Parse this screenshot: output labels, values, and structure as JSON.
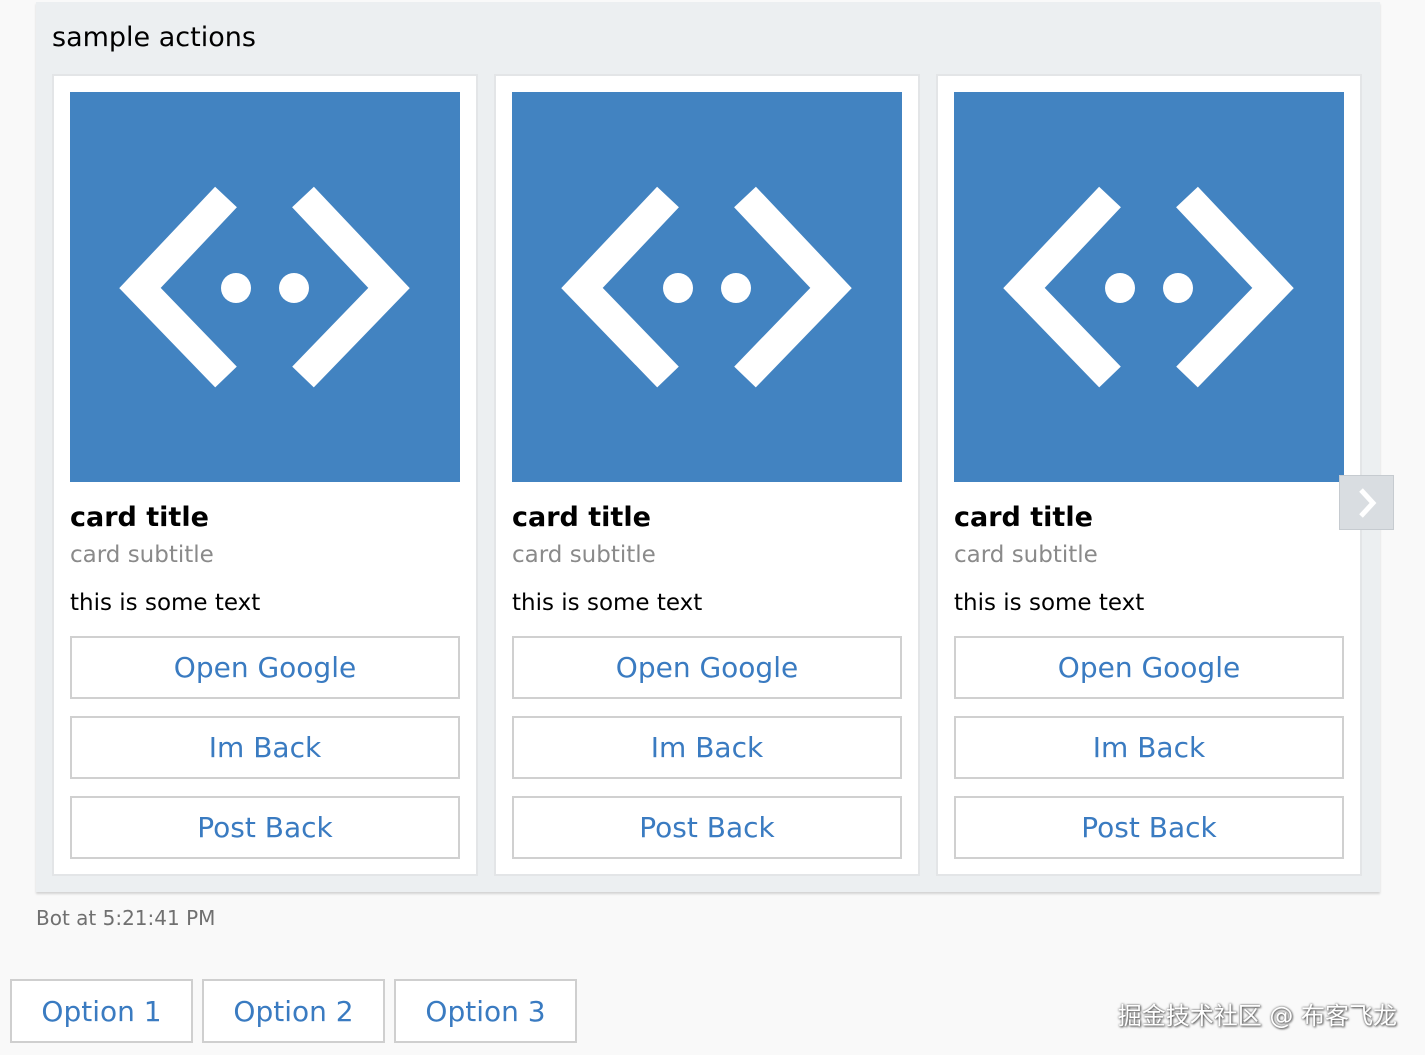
{
  "message": {
    "text": "sample actions",
    "timestamp": "Bot at 5:21:41 PM"
  },
  "cards": [
    {
      "title": "card title",
      "subtitle": "card subtitle",
      "text": "this is some text",
      "buttons": [
        "Open Google",
        "Im Back",
        "Post Back"
      ]
    },
    {
      "title": "card title",
      "subtitle": "card subtitle",
      "text": "this is some text",
      "buttons": [
        "Open Google",
        "Im Back",
        "Post Back"
      ]
    },
    {
      "title": "card title",
      "subtitle": "card subtitle",
      "text": "this is some text",
      "buttons": [
        "Open Google",
        "Im Back",
        "Post Back"
      ]
    }
  ],
  "suggested_actions": [
    "Option 1",
    "Option 2",
    "Option 3"
  ],
  "watermark": "掘金技术社区 @ 布客飞龙",
  "colors": {
    "accent": "#3a7bc1",
    "card_image_bg": "#4283c1",
    "bubble_bg": "#eceff1"
  },
  "icons": {
    "card_image": "bot-framework-code-icon",
    "carousel_next": "chevron-right-icon"
  }
}
